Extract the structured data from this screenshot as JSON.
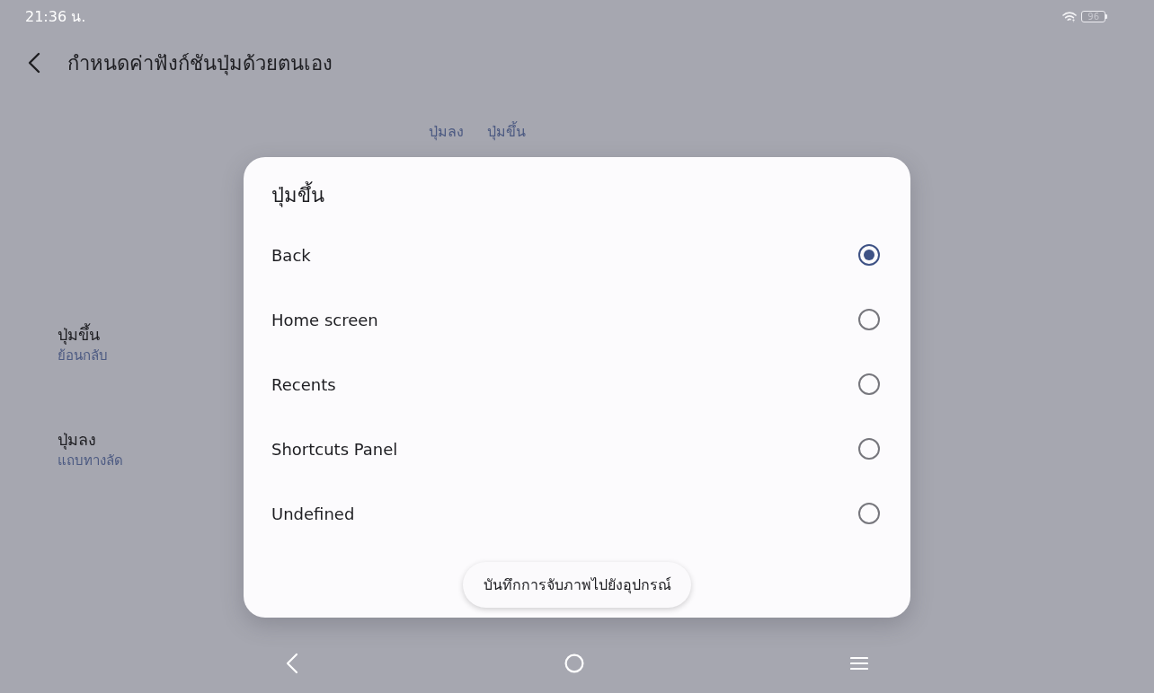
{
  "status_bar": {
    "time": "21:36 น.",
    "battery": "96"
  },
  "header": {
    "title": "กำหนดค่าฟังก์ชันปุ่มด้วยตนเอง"
  },
  "button_labels": [
    "ปุ่มลง",
    "ปุ่มขึ้น"
  ],
  "settings": [
    {
      "title": "ปุ่มขึ้น",
      "value": "ย้อนกลับ"
    },
    {
      "title": "ปุ่มลง",
      "value": "แถบทางลัด"
    }
  ],
  "dialog": {
    "title": "ปุ่มขึ้น",
    "options": [
      {
        "label": "Back",
        "selected": true
      },
      {
        "label": "Home screen",
        "selected": false
      },
      {
        "label": "Recents",
        "selected": false
      },
      {
        "label": "Shortcuts Panel",
        "selected": false
      },
      {
        "label": "Undefined",
        "selected": false
      }
    ]
  },
  "toast": {
    "text": "บันทึกการจับภาพไปยังอุปกรณ์"
  }
}
